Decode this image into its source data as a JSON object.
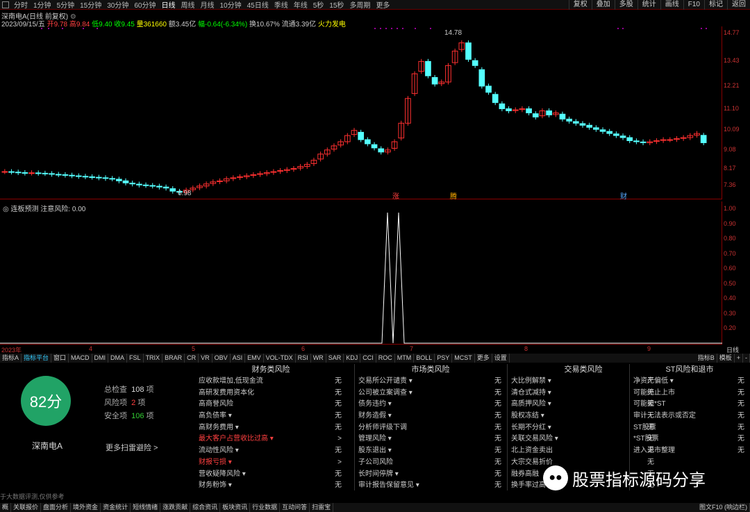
{
  "toolbar": {
    "periods": [
      "分时",
      "1分钟",
      "5分钟",
      "15分钟",
      "30分钟",
      "60分钟",
      "日线",
      "周线",
      "月线",
      "10分钟",
      "45日线",
      "季线",
      "年线",
      "5秒",
      "15秒",
      "多周期",
      "更多"
    ],
    "active": "日线",
    "right": [
      "复权",
      "叠加",
      "多股",
      "统计",
      "画线",
      "F10",
      "标记",
      "返回"
    ]
  },
  "header": {
    "title": "深南电A(日线 前复权)",
    "date": "2023/09/15/五",
    "open": "开9.78",
    "high": "高9.84",
    "low": "低9.40",
    "close": "收9.45",
    "vol": "量361660",
    "amt": "额3.45亿",
    "chg": "幅-0.64(-6.34%)",
    "turnover": "换10.67%",
    "float": "流通3.39亿",
    "concept": "火力发电"
  },
  "colors": {
    "up": "#ff3030",
    "down": "#54ffff",
    "grid": "#800000",
    "score": "#21a366"
  },
  "chart_data": {
    "type": "candlestick",
    "ylabels": [
      "14.77",
      "13.43",
      "12.21",
      "11.10",
      "10.09",
      "9.08",
      "8.17",
      "7.36"
    ],
    "high_label": "14.78",
    "low_label": "6.98",
    "markers": [
      "涨",
      "腾",
      "财"
    ]
  },
  "indicator": {
    "title": "连板预测 注意风险: 0.00",
    "ylabels": [
      "1.00",
      "0.90",
      "0.80",
      "0.70",
      "0.60",
      "0.50",
      "0.40",
      "0.30",
      "0.20"
    ]
  },
  "xaxis": {
    "labels": [
      "2023年",
      "4",
      "5",
      "6",
      "7",
      "8",
      "9"
    ],
    "right": "日线"
  },
  "tabs": [
    "指标A",
    "指标平台",
    "窗口",
    "MACD",
    "DMI",
    "DMA",
    "FSL",
    "TRIX",
    "BRAR",
    "CR",
    "VR",
    "OBV",
    "ASI",
    "EMV",
    "VOL-TDX",
    "RSI",
    "WR",
    "SAR",
    "KDJ",
    "CCI",
    "ROC",
    "MTM",
    "BOLL",
    "PSY",
    "MCST",
    "更多",
    "设置"
  ],
  "tabs_right": [
    "指标B",
    "模板",
    "+",
    "-"
  ],
  "score": {
    "value": "82分",
    "stock": "深南电A",
    "total_label": "总检查",
    "total": "108",
    "total_unit": "项",
    "risk_label": "风险项",
    "risk": "2",
    "risk_unit": "项",
    "safe_label": "安全项",
    "safe": "106",
    "safe_unit": "项",
    "more": "更多扫雷避险 >",
    "disclaimer": "于大数据评测,仅供参考"
  },
  "columns": [
    {
      "title": "财务类风险",
      "items": [
        [
          "应收款增加,低现金流",
          "无"
        ],
        [
          "高研发费用资本化",
          "无"
        ],
        [
          "高商誉风险",
          "无"
        ],
        [
          "高负债率 ▾",
          "无"
        ],
        [
          "高财务费用 ▾",
          "无"
        ],
        [
          "最大客户占营收比过高 ▾",
          ">"
        ],
        [
          "流动性风险 ▾",
          "无"
        ],
        [
          "财报亏损 ▾",
          ">"
        ],
        [
          "营收疑降风险 ▾",
          "无"
        ],
        [
          "财务粉饰 ▾",
          "无"
        ]
      ]
    },
    {
      "title": "市场类风险",
      "items": [
        [
          "交易所公开谴责 ▾",
          "无"
        ],
        [
          "公司被立案调查 ▾",
          "无"
        ],
        [
          "债务违约 ▾",
          "无"
        ],
        [
          "财务造假 ▾",
          "无"
        ],
        [
          "分析师评级下调",
          "无"
        ],
        [
          "管理风险 ▾",
          "无"
        ],
        [
          "股东退出 ▾",
          "无"
        ],
        [
          "子公司风险",
          "无"
        ],
        [
          "长时间停牌 ▾",
          "无"
        ],
        [
          "审计报告保留意见 ▾",
          "无"
        ]
      ]
    },
    {
      "title": "交易类风险",
      "items": [
        [
          "大比例解禁 ▾",
          "无"
        ],
        [
          "清仓式减持 ▾",
          "无"
        ],
        [
          "高质押风险 ▾",
          "无"
        ],
        [
          "股权冻结 ▾",
          "无"
        ],
        [
          "长期不分红 ▾",
          "无"
        ],
        [
          "关联交易风险 ▾",
          "无"
        ],
        [
          "北上资金卖出",
          "无"
        ],
        [
          "大宗交易折价",
          "无"
        ],
        [
          "融券高融",
          "无"
        ],
        [
          "换手率过高",
          "无"
        ]
      ]
    },
    {
      "title": "ST风险和退市",
      "items": [
        [
          "净资产偏低 ▾",
          "无"
        ],
        [
          "可能终止上市",
          "无"
        ],
        [
          "可能被*ST",
          "无"
        ],
        [
          "审计无法表示或否定",
          "无"
        ],
        [
          "ST股票",
          "无"
        ],
        [
          "*ST股票",
          "无"
        ],
        [
          "进入退市整理",
          "无"
        ]
      ]
    }
  ],
  "bottom": [
    "概",
    "关联报价",
    "盘面分析",
    "境外资金",
    "资金统计",
    "短线情绪",
    "涨跌贡献",
    "综合资讯",
    "板块资讯",
    "行业数据",
    "互动问答",
    "扫雷宝"
  ],
  "bottom_right": "图文F10 (响边栏)",
  "watermark": "股票指标源码分享"
}
